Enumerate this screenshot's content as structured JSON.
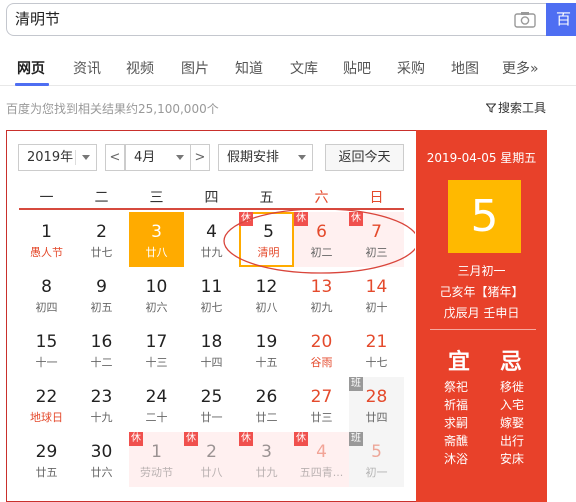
{
  "search": {
    "query": "清明节",
    "button_label": "百"
  },
  "tabs": [
    "网页",
    "资讯",
    "视频",
    "图片",
    "知道",
    "文库",
    "贴吧",
    "采购",
    "地图",
    "更多»"
  ],
  "result_stats": "百度为您找到相关结果约25,100,000个",
  "tools_label": "搜索工具",
  "calendar": {
    "year_select": "2019年",
    "month_select": "4月",
    "holiday_select": "假期安排",
    "prev_arrow": "<",
    "next_arrow": ">",
    "today_button": "返回今天",
    "weekdays": [
      "一",
      "二",
      "三",
      "四",
      "五",
      "六",
      "日"
    ],
    "weeks": [
      [
        {
          "day": "1",
          "lunar": "愚人节",
          "fest": true
        },
        {
          "day": "2",
          "lunar": "廿七"
        },
        {
          "day": "3",
          "lunar": "廿八",
          "today": true
        },
        {
          "day": "4",
          "lunar": "廿九"
        },
        {
          "day": "5",
          "lunar": "清明",
          "fest": true,
          "badge": "休",
          "selected": true
        },
        {
          "day": "6",
          "lunar": "初二",
          "badge": "休",
          "holiday": true
        },
        {
          "day": "7",
          "lunar": "初三",
          "badge": "休",
          "holiday": true
        }
      ],
      [
        {
          "day": "8",
          "lunar": "初四"
        },
        {
          "day": "9",
          "lunar": "初五"
        },
        {
          "day": "10",
          "lunar": "初六"
        },
        {
          "day": "11",
          "lunar": "初七"
        },
        {
          "day": "12",
          "lunar": "初八"
        },
        {
          "day": "13",
          "lunar": "初九"
        },
        {
          "day": "14",
          "lunar": "初十"
        }
      ],
      [
        {
          "day": "15",
          "lunar": "十一"
        },
        {
          "day": "16",
          "lunar": "十二"
        },
        {
          "day": "17",
          "lunar": "十三"
        },
        {
          "day": "18",
          "lunar": "十四"
        },
        {
          "day": "19",
          "lunar": "十五"
        },
        {
          "day": "20",
          "lunar": "谷雨",
          "fest": true
        },
        {
          "day": "21",
          "lunar": "十七"
        }
      ],
      [
        {
          "day": "22",
          "lunar": "地球日",
          "fest": true
        },
        {
          "day": "23",
          "lunar": "十九"
        },
        {
          "day": "24",
          "lunar": "二十"
        },
        {
          "day": "25",
          "lunar": "廿一"
        },
        {
          "day": "26",
          "lunar": "廿二"
        },
        {
          "day": "27",
          "lunar": "廿三"
        },
        {
          "day": "28",
          "lunar": "廿四",
          "badge": "班",
          "workday": true
        }
      ],
      [
        {
          "day": "29",
          "lunar": "廿五"
        },
        {
          "day": "30",
          "lunar": "廿六"
        },
        {
          "day": "1",
          "lunar": "劳动节",
          "badge": "休",
          "holiday": true,
          "other": true
        },
        {
          "day": "2",
          "lunar": "廿八",
          "badge": "休",
          "holiday": true,
          "other": true
        },
        {
          "day": "3",
          "lunar": "廿九",
          "badge": "休",
          "holiday": true,
          "other": true
        },
        {
          "day": "4",
          "lunar": "五四青...",
          "badge": "休",
          "holiday": true,
          "other": true
        },
        {
          "day": "5",
          "lunar": "初一",
          "badge": "班",
          "workday": true,
          "other": true
        }
      ]
    ]
  },
  "detail": {
    "date_line": "2019-04-05 星期五",
    "big_day": "5",
    "lunar_date": "三月初一",
    "year_ganzhi": "己亥年【猪年】",
    "month_day_ganzhi": "戊辰月 壬申日",
    "yi_label": "宜",
    "ji_label": "忌",
    "yi_items": [
      "祭祀",
      "祈福",
      "求嗣",
      "斋醮",
      "沐浴"
    ],
    "ji_items": [
      "移徙",
      "入宅",
      "嫁娶",
      "出行",
      "安床"
    ]
  },
  "colors": {
    "accent_red": "#e8412a",
    "today_yellow": "#ffab00",
    "link_blue": "#4e6ef2"
  }
}
